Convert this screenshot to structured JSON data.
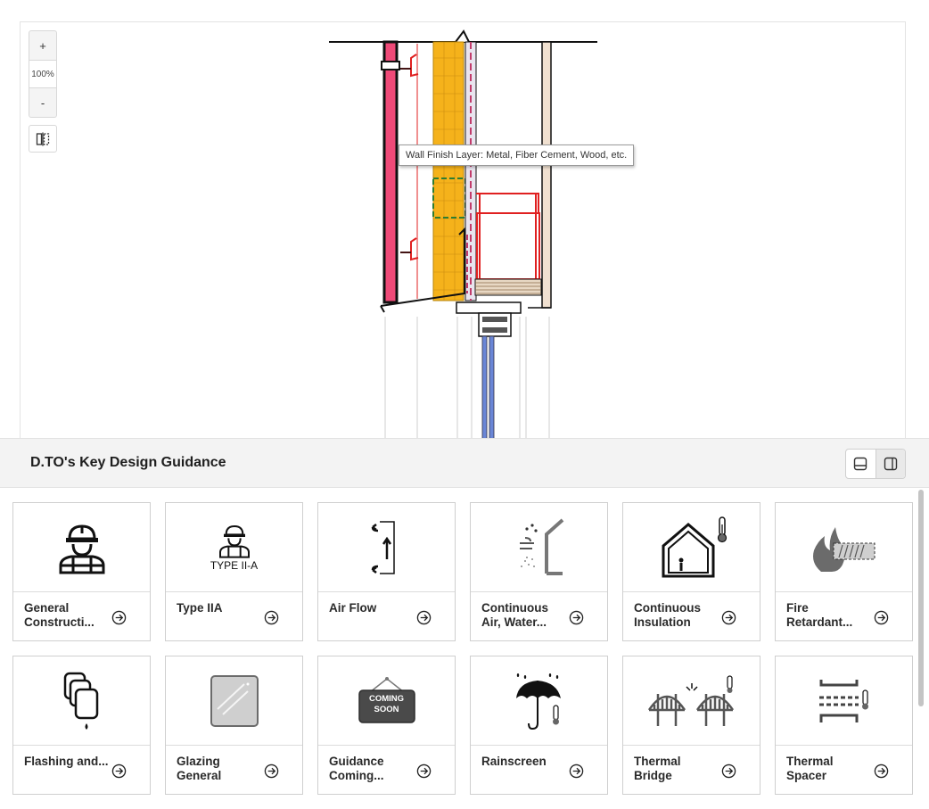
{
  "viewer": {
    "zoom_in_label": "+",
    "zoom_level": "100%",
    "zoom_out_label": "-",
    "tooltip": "Wall Finish Layer: Metal, Fiber Cement, Wood, etc."
  },
  "panel": {
    "title": "D.TO's Key Design Guidance"
  },
  "cards": [
    {
      "label": "General Constructi...",
      "icon": "construction-worker-icon"
    },
    {
      "label": "Type IIA",
      "icon": "worker-type-iia-icon",
      "icon_text": "TYPE II-A"
    },
    {
      "label": "Air Flow",
      "icon": "air-flow-icon"
    },
    {
      "label": "Continuous Air, Water...",
      "icon": "air-water-barrier-icon"
    },
    {
      "label": "Continuous Insulation",
      "icon": "insulated-house-icon"
    },
    {
      "label": "Fire Retardant...",
      "icon": "fire-retardant-icon"
    },
    {
      "label": "Flashing and...",
      "icon": "flashing-icon"
    },
    {
      "label": "Glazing General",
      "icon": "glass-pane-icon"
    },
    {
      "label": "Guidance Coming...",
      "icon": "coming-soon-sign-icon",
      "icon_text": "COMING SOON"
    },
    {
      "label": "Rainscreen",
      "icon": "umbrella-rain-icon"
    },
    {
      "label": "Thermal Bridge",
      "icon": "thermal-bridge-icon"
    },
    {
      "label": "Thermal Spacer",
      "icon": "thermal-spacer-icon"
    }
  ],
  "colors": {
    "insulation": "#f5b21b",
    "cladding": "#ef4a78",
    "framing": "#e02020",
    "accent_blue": "#6a86d6"
  }
}
